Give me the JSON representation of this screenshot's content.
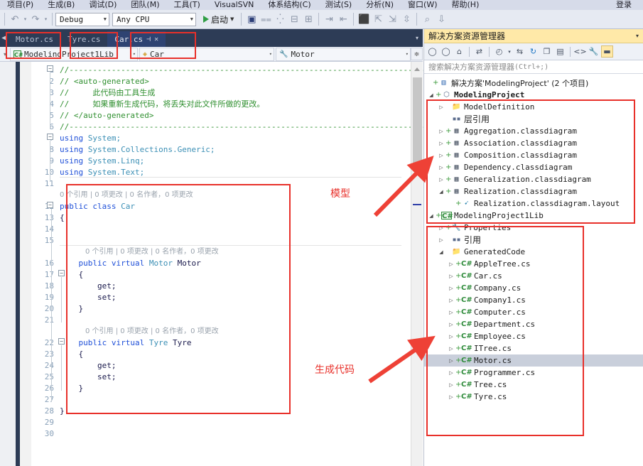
{
  "menu": {
    "items": [
      "项目(P)",
      "生成(B)",
      "调试(D)",
      "团队(M)",
      "工具(T)",
      "VisualSVN",
      "体系结构(C)",
      "测试(S)",
      "分析(N)",
      "窗口(W)",
      "帮助(H)"
    ],
    "signin": "登录"
  },
  "toolbar": {
    "undo": "↶",
    "redo": "↷",
    "config": "Debug",
    "platform": "Any CPU",
    "start_label": "启动",
    "icons": [
      "attach-icon",
      "step-icon",
      "comment-icon",
      "uncomment-icon",
      "indent-icon",
      "outdent-icon",
      "bookmark-icon",
      "bookmark-prev-icon",
      "bookmark-next-icon",
      "bookmark-clear-icon",
      "find-icon",
      "sort-icon"
    ]
  },
  "tabs": {
    "left_scroll": "◀",
    "items": [
      {
        "label": "Motor.cs",
        "selected": false
      },
      {
        "label": "Tyre.cs",
        "selected": false
      },
      {
        "label": "Car.cs",
        "selected": true
      }
    ],
    "pin": "⊣",
    "close": "✕",
    "overflow": "▾"
  },
  "navbar": {
    "project": "ModelingProject1Lib",
    "type": "Car",
    "member": "Motor",
    "cs_badge": "C#",
    "arrow": "▾"
  },
  "editor": {
    "line_numbers": [
      1,
      2,
      3,
      4,
      5,
      6,
      7,
      8,
      9,
      10,
      11,
      12,
      13,
      14,
      15,
      16,
      17,
      18,
      19,
      20,
      21,
      22,
      23,
      24,
      25,
      26,
      27,
      28,
      29,
      30
    ],
    "codelens_text": "0 个引用 | 0 项更改 | 0 名作者，0 项更改",
    "lines": [
      {
        "n": 1,
        "kind": "comment",
        "text": "//------------------------------------------------------------------------------"
      },
      {
        "n": 2,
        "kind": "comment",
        "text": "// <auto-generated>"
      },
      {
        "n": 3,
        "kind": "comment",
        "text": "//     此代码由工具生成"
      },
      {
        "n": 4,
        "kind": "comment",
        "text": "//     如果重新生成代码，将丢失对此文件所做的更改。"
      },
      {
        "n": 5,
        "kind": "comment",
        "text": "// </auto-generated>"
      },
      {
        "n": 6,
        "kind": "comment",
        "text": "//------------------------------------------------------------------------------"
      },
      {
        "n": 7,
        "kind": "using",
        "kw": "using",
        "rest": " System;"
      },
      {
        "n": 8,
        "kind": "using",
        "kw": "using",
        "rest": " System.Collections.Generic;"
      },
      {
        "n": 9,
        "kind": "using",
        "kw": "using",
        "rest": " System.Linq;"
      },
      {
        "n": 10,
        "kind": "using",
        "kw": "using",
        "rest": " System.Text;"
      },
      {
        "n": 11,
        "kind": "blank",
        "text": ""
      },
      {
        "n": 12,
        "kind": "class",
        "text": "public class Car"
      },
      {
        "n": 13,
        "kind": "plain",
        "text": "{"
      },
      {
        "n": 14,
        "kind": "blank",
        "text": ""
      },
      {
        "n": 15,
        "kind": "blank",
        "text": ""
      },
      {
        "n": 16,
        "kind": "prop",
        "text": "    public virtual Motor Motor"
      },
      {
        "n": 17,
        "kind": "plain",
        "text": "    {"
      },
      {
        "n": 18,
        "kind": "plain",
        "text": "        get;"
      },
      {
        "n": 19,
        "kind": "plain",
        "text": "        set;"
      },
      {
        "n": 20,
        "kind": "plain",
        "text": "    }"
      },
      {
        "n": 21,
        "kind": "blank",
        "text": ""
      },
      {
        "n": 22,
        "kind": "prop",
        "text": "    public virtual Tyre Tyre"
      },
      {
        "n": 23,
        "kind": "plain",
        "text": "    {"
      },
      {
        "n": 24,
        "kind": "plain",
        "text": "        get;"
      },
      {
        "n": 25,
        "kind": "plain",
        "text": "        set;"
      },
      {
        "n": 26,
        "kind": "plain",
        "text": "    }"
      },
      {
        "n": 27,
        "kind": "blank",
        "text": ""
      },
      {
        "n": 28,
        "kind": "plain",
        "text": "}"
      },
      {
        "n": 29,
        "kind": "blank",
        "text": ""
      },
      {
        "n": 30,
        "kind": "blank",
        "text": ""
      }
    ],
    "code_tokens": {
      "kw_public": "public",
      "kw_class": "class",
      "kw_virtual": "virtual",
      "id_car": "Car",
      "typ_motor": "Motor",
      "id_motor": "Motor",
      "typ_tyre": "Tyre",
      "id_tyre": "Tyre",
      "get": "get;",
      "set": "set;"
    }
  },
  "solution_explorer": {
    "title": "解决方案资源管理器",
    "collapse_caret": "▾",
    "search_placeholder": "搜索解决方案资源管理器",
    "search_shortcut": "(Ctrl+;)",
    "toolbar_icons": [
      "back-icon",
      "forward-icon",
      "home-icon",
      "sync-with-active-document-icon",
      "pending-changes-icon",
      "refresh-icon",
      "collapse-all-icon",
      "show-all-files-icon",
      "properties-icon",
      "preview-icon",
      "code-view-icon",
      "properties-window-icon",
      "show-hide-icon"
    ],
    "root": {
      "label": "解决方案'ModelingProject'  (2 个项目)",
      "icon": "solution-icon"
    },
    "tree": [
      {
        "indent": 0,
        "exp": "◢",
        "plus": "+",
        "icon": "modeling-project-icon",
        "label": "ModelingProject",
        "bold": true
      },
      {
        "indent": 1,
        "exp": "▷",
        "plus": "",
        "icon": "folder-icon",
        "label": "ModelDefinition"
      },
      {
        "indent": 1,
        "exp": "",
        "plus": "",
        "icon": "references-icon",
        "label": "层引用",
        "cjk": true
      },
      {
        "indent": 1,
        "exp": "▷",
        "plus": "+",
        "icon": "classdiagram-icon",
        "label": "Aggregation.classdiagram"
      },
      {
        "indent": 1,
        "exp": "▷",
        "plus": "+",
        "icon": "classdiagram-icon",
        "label": "Association.classdiagram"
      },
      {
        "indent": 1,
        "exp": "▷",
        "plus": "+",
        "icon": "classdiagram-icon",
        "label": "Composition.classdiagram"
      },
      {
        "indent": 1,
        "exp": "▷",
        "plus": "+",
        "icon": "classdiagram-icon",
        "label": "Dependency.classdiagram"
      },
      {
        "indent": 1,
        "exp": "▷",
        "plus": "+",
        "icon": "classdiagram-icon",
        "label": "Generalization.classdiagram"
      },
      {
        "indent": 1,
        "exp": "◢",
        "plus": "+",
        "icon": "classdiagram-icon",
        "label": "Realization.classdiagram"
      },
      {
        "indent": 2,
        "exp": "",
        "plus": "+",
        "icon": "layout-icon",
        "label": "Realization.classdiagram.layout"
      }
    ],
    "tree2": [
      {
        "indent": 0,
        "exp": "◢",
        "plus": "+",
        "icon": "csharp-project-icon",
        "label": "ModelingProject1Lib"
      },
      {
        "indent": 1,
        "exp": "▷",
        "plus": "+",
        "icon": "wrench-icon",
        "label": "Properties"
      },
      {
        "indent": 1,
        "exp": "▷",
        "plus": "",
        "icon": "references-icon",
        "label": "引用",
        "cjk": true
      },
      {
        "indent": 1,
        "exp": "◢",
        "plus": "",
        "icon": "folder-icon",
        "label": "GeneratedCode"
      },
      {
        "indent": 2,
        "exp": "▷",
        "plus": "+",
        "icon": "csharp-file-icon",
        "label": "AppleTree.cs"
      },
      {
        "indent": 2,
        "exp": "▷",
        "plus": "+",
        "icon": "csharp-file-icon",
        "label": "Car.cs"
      },
      {
        "indent": 2,
        "exp": "▷",
        "plus": "+",
        "icon": "csharp-file-icon",
        "label": "Company.cs"
      },
      {
        "indent": 2,
        "exp": "▷",
        "plus": "+",
        "icon": "csharp-file-icon",
        "label": "Company1.cs"
      },
      {
        "indent": 2,
        "exp": "▷",
        "plus": "+",
        "icon": "csharp-file-icon",
        "label": "Computer.cs"
      },
      {
        "indent": 2,
        "exp": "▷",
        "plus": "+",
        "icon": "csharp-file-icon",
        "label": "Department.cs"
      },
      {
        "indent": 2,
        "exp": "▷",
        "plus": "+",
        "icon": "csharp-file-icon",
        "label": "Employee.cs"
      },
      {
        "indent": 2,
        "exp": "▷",
        "plus": "+",
        "icon": "csharp-file-icon",
        "label": "ITree.cs"
      },
      {
        "indent": 2,
        "exp": "▷",
        "plus": "+",
        "icon": "csharp-file-icon",
        "label": "Motor.cs",
        "selected": true
      },
      {
        "indent": 2,
        "exp": "▷",
        "plus": "+",
        "icon": "csharp-file-icon",
        "label": "Programmer.cs"
      },
      {
        "indent": 2,
        "exp": "▷",
        "plus": "+",
        "icon": "csharp-file-icon",
        "label": "Tree.cs"
      },
      {
        "indent": 2,
        "exp": "▷",
        "plus": "+",
        "icon": "csharp-file-icon",
        "label": "Tyre.cs"
      }
    ]
  },
  "annotations": {
    "color": "#e8302a",
    "label_model": "模型",
    "label_generated_code": "生成代码"
  }
}
